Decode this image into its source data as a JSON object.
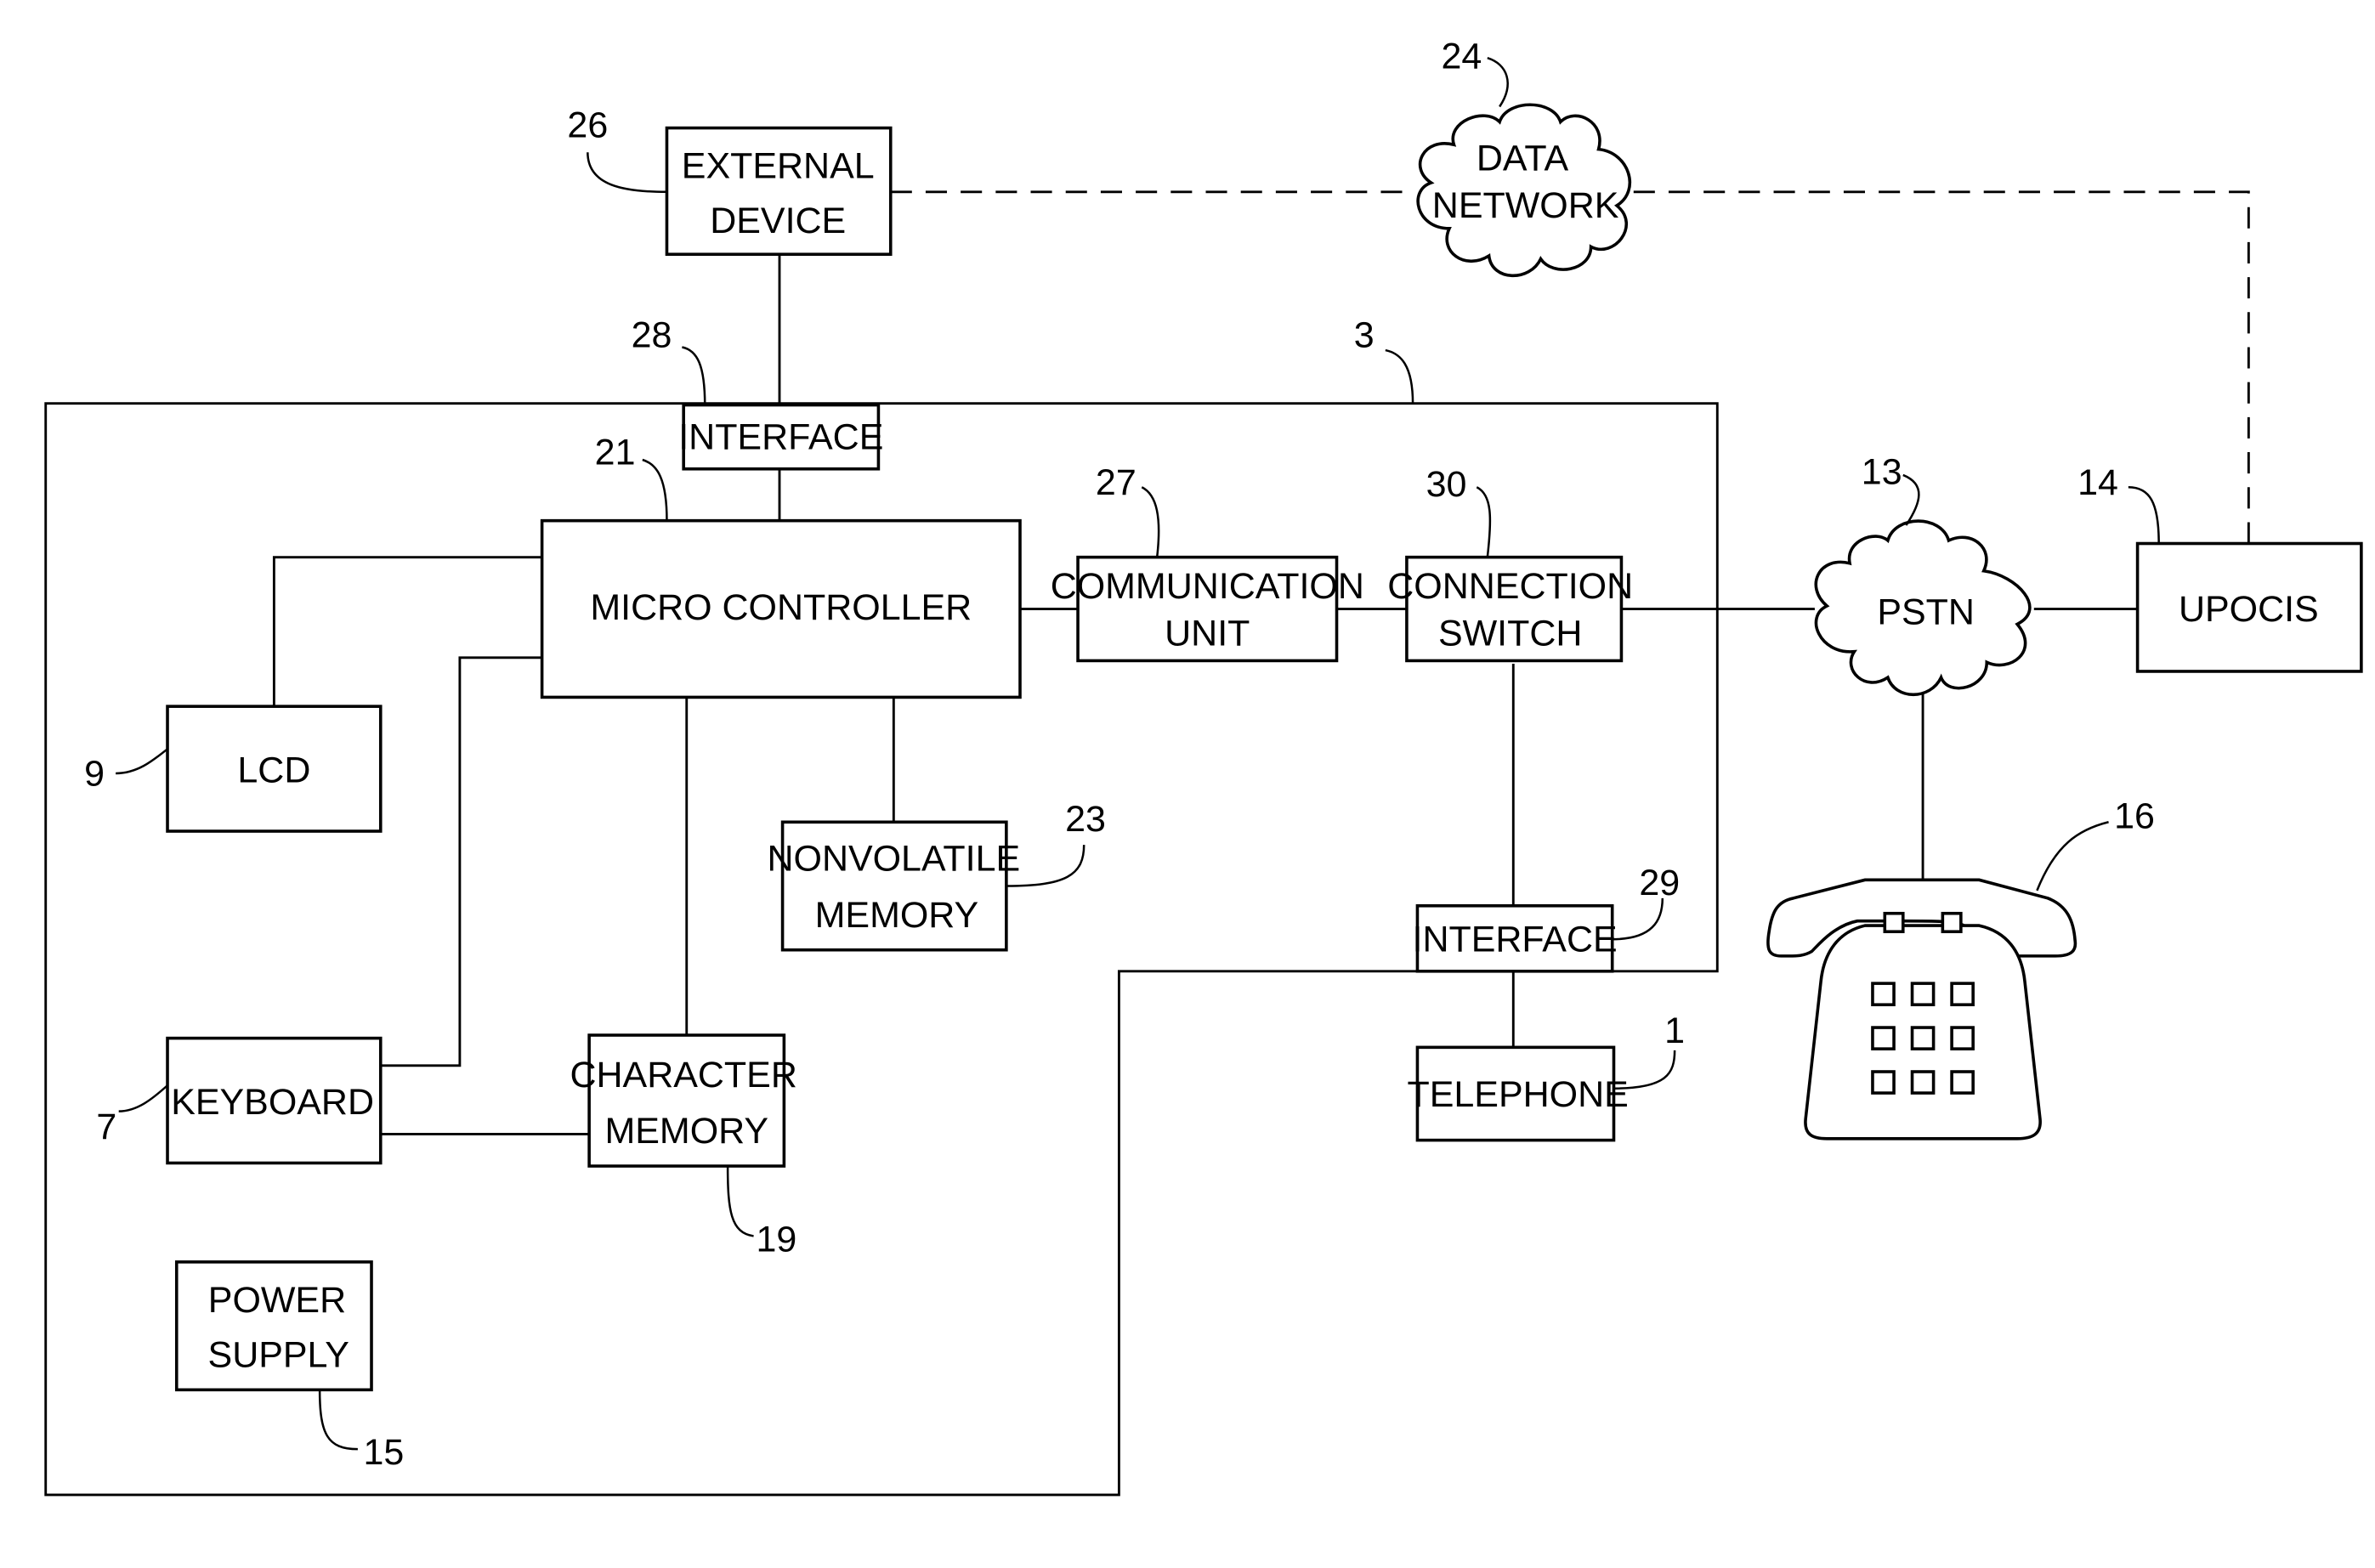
{
  "figure": {
    "blocks": {
      "external_device": {
        "line1": "EXTERNAL",
        "line2": "DEVICE",
        "ref": "26"
      },
      "data_network": {
        "line1": "DATA",
        "line2": "NETWORK",
        "ref": "24"
      },
      "interface_top": {
        "label": "INTERFACE",
        "ref": "28"
      },
      "device_enclosure": {
        "ref": "3"
      },
      "micro_controller": {
        "label": "MICRO CONTROLLER",
        "ref": "21"
      },
      "communication_unit": {
        "line1": "COMMUNICATION",
        "line2": "UNIT",
        "ref": "27"
      },
      "connection_switch": {
        "line1": "CONNECTION",
        "line2": "SWITCH",
        "ref": "30"
      },
      "pstn": {
        "label": "PSTN",
        "ref": "13"
      },
      "upocis": {
        "label": "UPOCIS",
        "ref": "14"
      },
      "lcd": {
        "label": "LCD",
        "ref": "9"
      },
      "nonvolatile_memory": {
        "line1": "NONVOLATILE",
        "line2": "MEMORY",
        "ref": "23"
      },
      "interface_bottom": {
        "label": "INTERFACE",
        "ref": "29"
      },
      "telephone_block": {
        "label": "TELEPHONE",
        "ref": "1"
      },
      "telephone_icon": {
        "ref": "16"
      },
      "keyboard": {
        "label": "KEYBOARD",
        "ref": "7"
      },
      "character_memory": {
        "line1": "CHARACTER",
        "line2": "MEMORY",
        "ref": "19"
      },
      "power_supply": {
        "line1": "POWER",
        "line2": "SUPPLY",
        "ref": "15"
      }
    }
  }
}
